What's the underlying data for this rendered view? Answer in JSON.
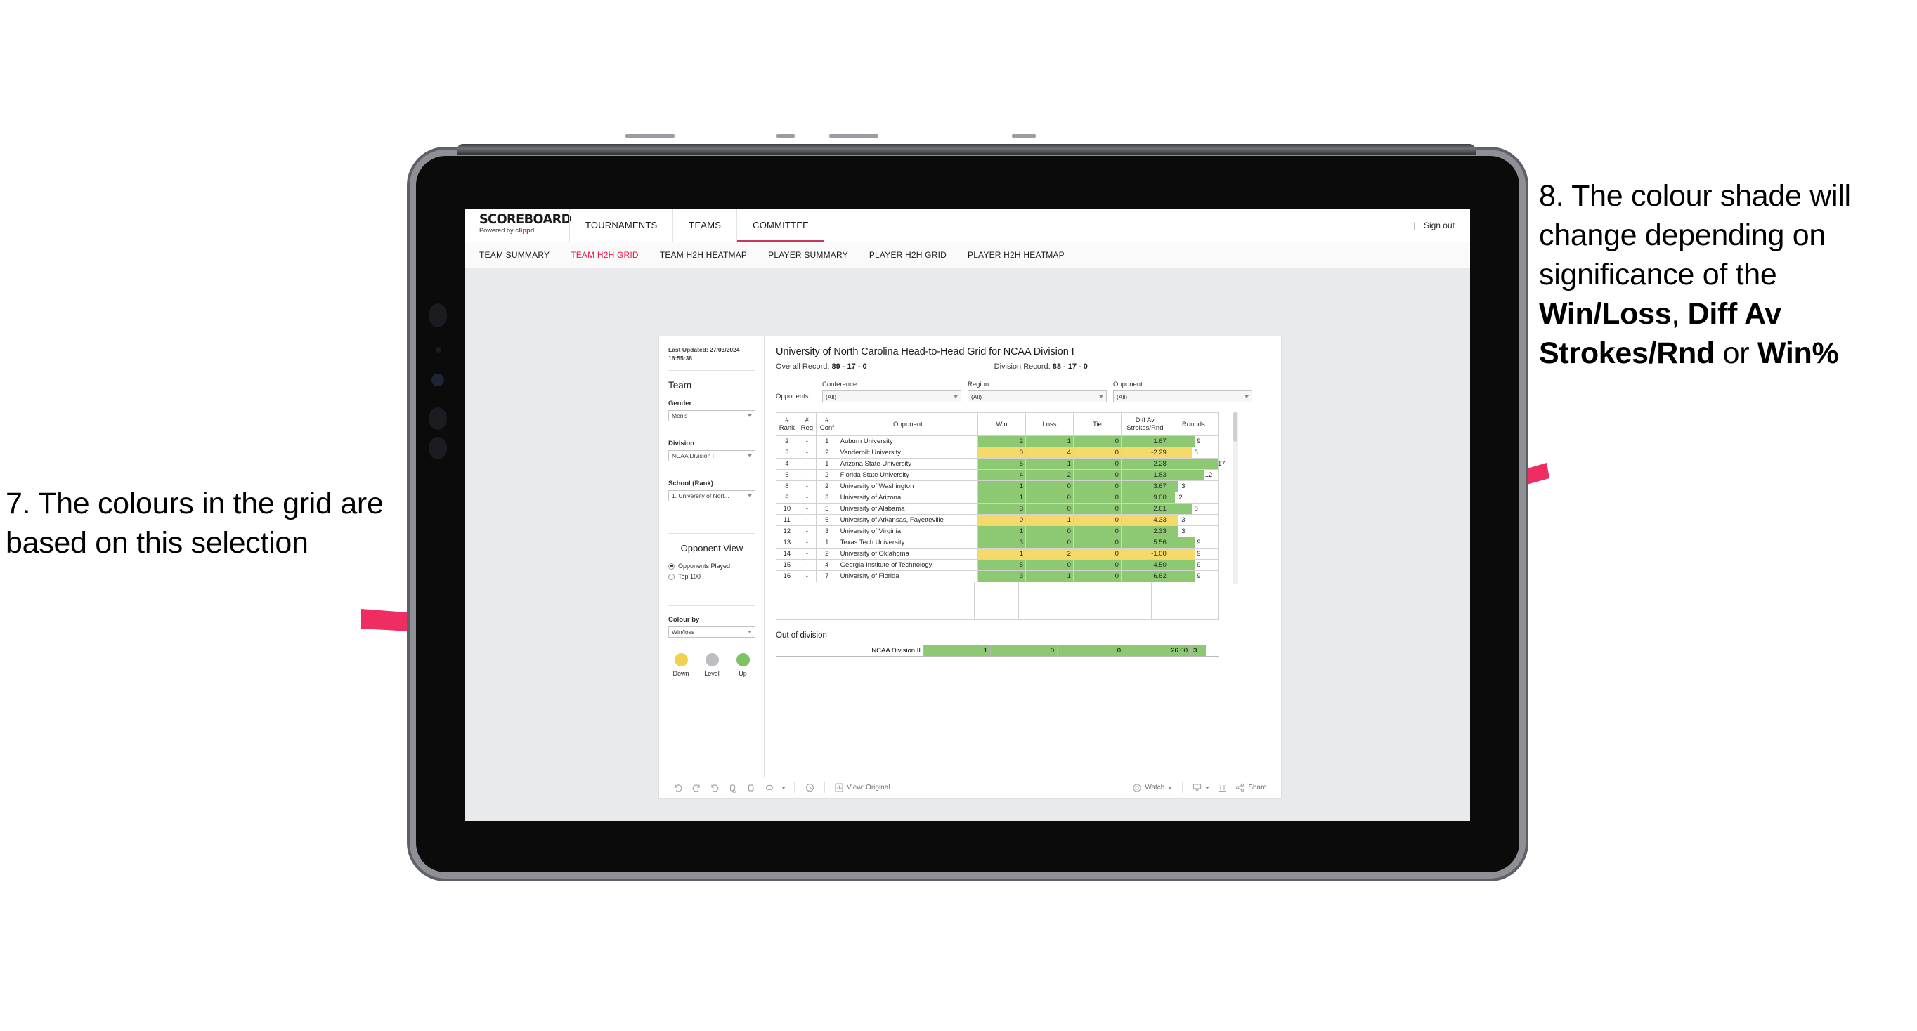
{
  "annotations": {
    "left": {
      "id": "7.",
      "text": "7. The colours in the grid are based on this selection"
    },
    "right": {
      "part1": "8. The colour shade will change depending on significance of the ",
      "bold1": "Win/Loss",
      "mid1": ", ",
      "bold2": "Diff Av Strokes/Rnd",
      "mid2": " or ",
      "bold3": "Win%"
    },
    "arrow_color": "#ef2d63"
  },
  "app": {
    "logo": {
      "main": "SCOREBOARD",
      "sub_prefix": "Powered by ",
      "sub_brand": "clippd"
    },
    "top_nav": [
      {
        "label": "TOURNAMENTS",
        "active": false
      },
      {
        "label": "TEAMS",
        "active": false
      },
      {
        "label": "COMMITTEE",
        "active": true
      }
    ],
    "sign_out": "Sign out",
    "sub_nav": [
      {
        "label": "TEAM SUMMARY",
        "active": false
      },
      {
        "label": "TEAM H2H GRID",
        "active": true
      },
      {
        "label": "TEAM H2H HEATMAP",
        "active": false
      },
      {
        "label": "PLAYER SUMMARY",
        "active": false
      },
      {
        "label": "PLAYER H2H GRID",
        "active": false
      },
      {
        "label": "PLAYER H2H HEATMAP",
        "active": false
      }
    ],
    "accent": "#e8174a"
  },
  "panel": {
    "last_updated_label": "Last Updated:",
    "last_updated_value": "27/03/2024 16:55:38",
    "team_heading": "Team",
    "gender_label": "Gender",
    "gender_value": "Men's",
    "division_label": "Division",
    "division_value": "NCAA Division I",
    "school_label": "School (Rank)",
    "school_value": "1. University of Nort...",
    "opponent_view_heading": "Opponent View",
    "opponent_view_options": [
      {
        "label": "Opponents Played",
        "selected": true
      },
      {
        "label": "Top 100",
        "selected": false
      }
    ],
    "colour_by_label": "Colour by",
    "colour_by_value": "Win/loss",
    "legend": [
      {
        "label": "Down",
        "color": "#f2d24b"
      },
      {
        "label": "Level",
        "color": "#bcbec1"
      },
      {
        "label": "Up",
        "color": "#7cc462"
      }
    ]
  },
  "viz": {
    "title": "University of North Carolina Head-to-Head Grid for NCAA Division I",
    "overall_record_label": "Overall Record:",
    "overall_record_value": "89 - 17 - 0",
    "division_record_label": "Division Record:",
    "division_record_value": "88 - 17 - 0",
    "opponents_label": "Opponents:",
    "filters": [
      {
        "caption": "Conference",
        "value": "(All)"
      },
      {
        "caption": "Region",
        "value": "(All)"
      },
      {
        "caption": "Opponent",
        "value": "(All)"
      }
    ],
    "columns": [
      {
        "l1": "#",
        "l2": "Rank"
      },
      {
        "l1": "#",
        "l2": "Reg"
      },
      {
        "l1": "#",
        "l2": "Conf"
      },
      {
        "l1": "Opponent",
        "l2": ""
      },
      {
        "l1": "Win",
        "l2": ""
      },
      {
        "l1": "Loss",
        "l2": ""
      },
      {
        "l1": "Tie",
        "l2": ""
      },
      {
        "l1": "Diff Av",
        "l2": "Strokes/Rnd"
      },
      {
        "l1": "Rounds",
        "l2": ""
      }
    ],
    "rows": [
      {
        "rank": "2",
        "reg": "-",
        "conf": "1",
        "opponent": "Auburn University",
        "win": "2",
        "loss": "1",
        "tie": "0",
        "diff": "1.67",
        "rounds": "9",
        "tone": "up"
      },
      {
        "rank": "3",
        "reg": "-",
        "conf": "2",
        "opponent": "Vanderbilt University",
        "win": "0",
        "loss": "4",
        "tie": "0",
        "diff": "-2.29",
        "rounds": "8",
        "tone": "down"
      },
      {
        "rank": "4",
        "reg": "-",
        "conf": "1",
        "opponent": "Arizona State University",
        "win": "5",
        "loss": "1",
        "tie": "0",
        "diff": "2.28",
        "rounds": "17",
        "tone": "up"
      },
      {
        "rank": "6",
        "reg": "-",
        "conf": "2",
        "opponent": "Florida State University",
        "win": "4",
        "loss": "2",
        "tie": "0",
        "diff": "1.83",
        "rounds": "12",
        "tone": "up"
      },
      {
        "rank": "8",
        "reg": "-",
        "conf": "2",
        "opponent": "University of Washington",
        "win": "1",
        "loss": "0",
        "tie": "0",
        "diff": "3.67",
        "rounds": "3",
        "tone": "up"
      },
      {
        "rank": "9",
        "reg": "-",
        "conf": "3",
        "opponent": "University of Arizona",
        "win": "1",
        "loss": "0",
        "tie": "0",
        "diff": "9.00",
        "rounds": "2",
        "tone": "up"
      },
      {
        "rank": "10",
        "reg": "-",
        "conf": "5",
        "opponent": "University of Alabama",
        "win": "3",
        "loss": "0",
        "tie": "0",
        "diff": "2.61",
        "rounds": "8",
        "tone": "up"
      },
      {
        "rank": "11",
        "reg": "-",
        "conf": "6",
        "opponent": "University of Arkansas, Fayetteville",
        "win": "0",
        "loss": "1",
        "tie": "0",
        "diff": "-4.33",
        "rounds": "3",
        "tone": "down"
      },
      {
        "rank": "12",
        "reg": "-",
        "conf": "3",
        "opponent": "University of Virginia",
        "win": "1",
        "loss": "0",
        "tie": "0",
        "diff": "2.33",
        "rounds": "3",
        "tone": "up"
      },
      {
        "rank": "13",
        "reg": "-",
        "conf": "1",
        "opponent": "Texas Tech University",
        "win": "3",
        "loss": "0",
        "tie": "0",
        "diff": "5.56",
        "rounds": "9",
        "tone": "up"
      },
      {
        "rank": "14",
        "reg": "-",
        "conf": "2",
        "opponent": "University of Oklahoma",
        "win": "1",
        "loss": "2",
        "tie": "0",
        "diff": "-1.00",
        "rounds": "9",
        "tone": "down"
      },
      {
        "rank": "15",
        "reg": "-",
        "conf": "4",
        "opponent": "Georgia Institute of Technology",
        "win": "5",
        "loss": "0",
        "tie": "0",
        "diff": "4.50",
        "rounds": "9",
        "tone": "up"
      },
      {
        "rank": "16",
        "reg": "-",
        "conf": "7",
        "opponent": "University of Florida",
        "win": "3",
        "loss": "1",
        "tie": "0",
        "diff": "6.62",
        "rounds": "9",
        "tone": "up"
      }
    ],
    "out_of_division_title": "Out of division",
    "out_of_division_row": {
      "label": "NCAA Division II",
      "win": "1",
      "loss": "0",
      "tie": "0",
      "diff": "26.00",
      "rounds": "3",
      "tone": "up"
    },
    "colors": {
      "up": "#8dc972",
      "down": "#f5d96b",
      "level": "#bcbec1"
    }
  },
  "toolbar": {
    "icons": [
      "undo-icon",
      "redo-icon",
      "revert-icon",
      "refresh-icon",
      "pause-icon",
      "alerts-icon"
    ],
    "view_label": "View: Original",
    "watch_label": "Watch",
    "share_label": "Share"
  },
  "chart_data": {
    "type": "table",
    "title": "University of North Carolina Head-to-Head Grid for NCAA Division I",
    "columns": [
      "# Rank",
      "# Reg",
      "# Conf",
      "Opponent",
      "Win",
      "Loss",
      "Tie",
      "Diff Av Strokes/Rnd",
      "Rounds"
    ],
    "rows": [
      [
        "2",
        "-",
        "1",
        "Auburn University",
        2,
        1,
        0,
        1.67,
        9
      ],
      [
        "3",
        "-",
        "2",
        "Vanderbilt University",
        0,
        4,
        0,
        -2.29,
        8
      ],
      [
        "4",
        "-",
        "1",
        "Arizona State University",
        5,
        1,
        0,
        2.28,
        17
      ],
      [
        "6",
        "-",
        "2",
        "Florida State University",
        4,
        2,
        0,
        1.83,
        12
      ],
      [
        "8",
        "-",
        "2",
        "University of Washington",
        1,
        0,
        0,
        3.67,
        3
      ],
      [
        "9",
        "-",
        "3",
        "University of Arizona",
        1,
        0,
        0,
        9.0,
        2
      ],
      [
        "10",
        "-",
        "5",
        "University of Alabama",
        3,
        0,
        0,
        2.61,
        8
      ],
      [
        "11",
        "-",
        "6",
        "University of Arkansas, Fayetteville",
        0,
        1,
        0,
        -4.33,
        3
      ],
      [
        "12",
        "-",
        "3",
        "University of Virginia",
        1,
        0,
        0,
        2.33,
        3
      ],
      [
        "13",
        "-",
        "1",
        "Texas Tech University",
        3,
        0,
        0,
        5.56,
        9
      ],
      [
        "14",
        "-",
        "2",
        "University of Oklahoma",
        1,
        2,
        0,
        -1.0,
        9
      ],
      [
        "15",
        "-",
        "4",
        "Georgia Institute of Technology",
        5,
        0,
        0,
        4.5,
        9
      ],
      [
        "16",
        "-",
        "7",
        "University of Florida",
        3,
        1,
        0,
        6.62,
        9
      ],
      [
        "",
        "",
        "",
        "NCAA Division II (out of division)",
        1,
        0,
        0,
        26.0,
        3
      ]
    ],
    "colour_encoding": "Win/loss — green = Up (winning record), yellow = Down (losing record), grey = Level",
    "overall_record": "89 - 17 - 0",
    "division_record": "88 - 17 - 0"
  }
}
